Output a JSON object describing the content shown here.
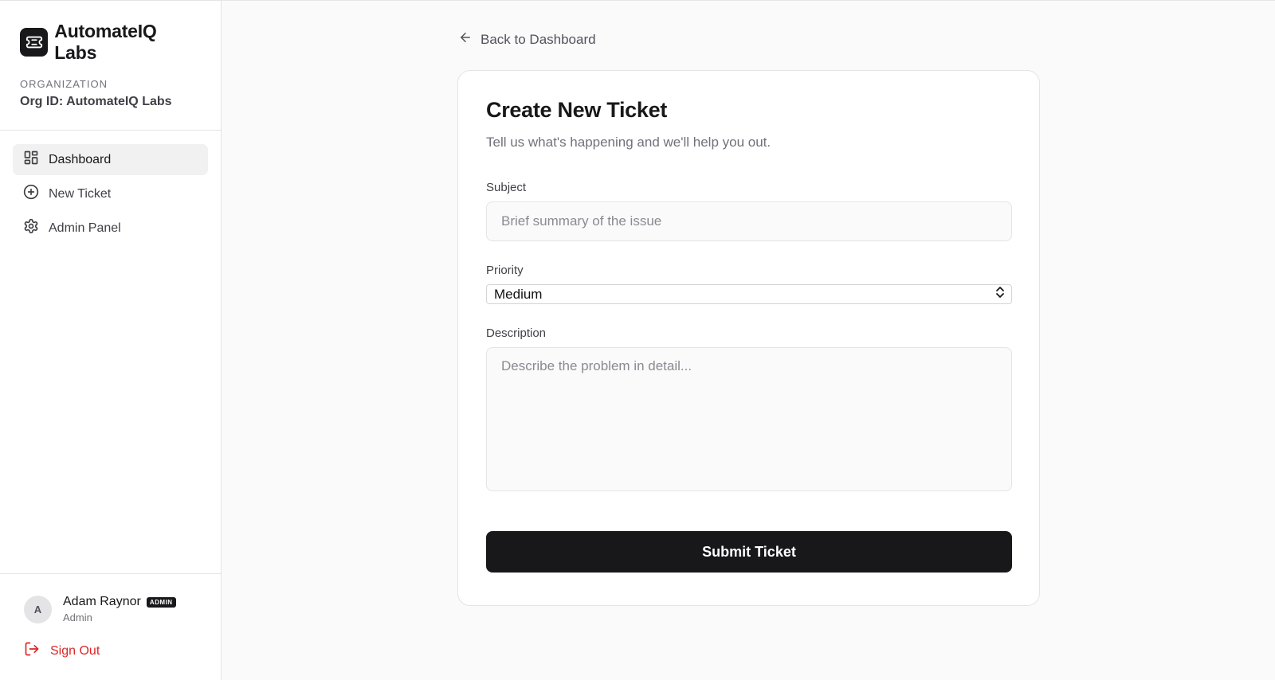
{
  "sidebar": {
    "brand_name": "AutomateIQ Labs",
    "brand_icon": "ticket-icon",
    "org_label": "ORGANIZATION",
    "org_id": "Org ID: AutomateIQ Labs",
    "nav": [
      {
        "label": "Dashboard",
        "icon": "dashboard-grid-icon",
        "active": true
      },
      {
        "label": "New Ticket",
        "icon": "plus-circle-icon",
        "active": false
      },
      {
        "label": "Admin Panel",
        "icon": "gear-icon",
        "active": false
      }
    ],
    "user": {
      "initial": "A",
      "name": "Adam Raynor",
      "badge": "ADMIN",
      "role": "Admin"
    },
    "signout_label": "Sign Out"
  },
  "main": {
    "back_label": "Back to Dashboard",
    "form": {
      "title": "Create New Ticket",
      "subtitle": "Tell us what's happening and we'll help you out.",
      "subject_label": "Subject",
      "subject_placeholder": "Brief summary of the issue",
      "subject_value": "",
      "priority_label": "Priority",
      "priority_value": "Medium",
      "description_label": "Description",
      "description_placeholder": "Describe the problem in detail...",
      "description_value": "",
      "submit_label": "Submit Ticket"
    }
  },
  "colors": {
    "primary": "#18181b",
    "danger": "#dc2626",
    "background": "#fafafa",
    "border": "#e4e4e7"
  }
}
